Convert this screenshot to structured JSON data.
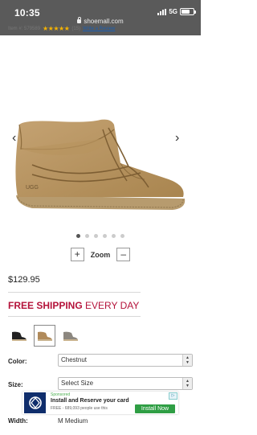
{
  "status_bar": {
    "time": "10:35",
    "network": "5G",
    "url": "shoemall.com"
  },
  "review_row": {
    "item_text": "Item #: 579589",
    "stars": "★★★★★",
    "review_count": "(15)",
    "write_review": "Write a Review"
  },
  "carousel": {
    "prev": "‹",
    "next": "›",
    "image_count": 6,
    "active_index": 0
  },
  "zoom": {
    "plus": "+",
    "label": "Zoom",
    "minus": "–"
  },
  "price": "$129.95",
  "shipping": {
    "bold": "FREE SHIPPING",
    "light": "EVERY DAY"
  },
  "swatches": [
    {
      "name": "Black",
      "color": "#222222",
      "selected": false
    },
    {
      "name": "Chestnut",
      "color": "#b08a5a",
      "selected": true
    },
    {
      "name": "Gray",
      "color": "#8c877f",
      "selected": false
    }
  ],
  "color_field": {
    "label": "Color:",
    "value": "Chestnut"
  },
  "size_field": {
    "label": "Size:",
    "value": "Select Size"
  },
  "width_field": {
    "label": "Width:",
    "value": "M Medium"
  },
  "ad": {
    "sponsored": "Sponsored",
    "title": "Install and Reserve your card",
    "subtitle": "FREE - 689,093 people use this",
    "button": "Install Now",
    "choices": "▷"
  }
}
